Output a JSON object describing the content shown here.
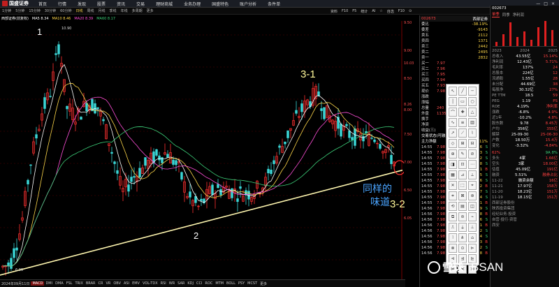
{
  "app": {
    "logo_text": "国盛证券",
    "menu": [
      "首页",
      "行情",
      "发现",
      "股票",
      "资讯",
      "交易",
      "理财商城",
      "业务办理",
      "国盛特色",
      "账户分析",
      "条件单"
    ],
    "right_icons": [
      "—",
      "□",
      "×"
    ]
  },
  "toolbar": {
    "periods": [
      "1分钟",
      "5分钟",
      "15分钟",
      "30分钟",
      "60分钟",
      "日线",
      "周线",
      "月线",
      "季线",
      "年线",
      "多周期",
      "更多"
    ],
    "active_period": "日线",
    "right_items": [
      "资料",
      "F10",
      "F5",
      "统计",
      "AI",
      "☆",
      "自选",
      "F10",
      "⊙"
    ]
  },
  "legend": {
    "stock": "西部证券(前复权)",
    "ma5": "MA5 8.34",
    "ma10": "MA10 8.46",
    "ma20": "MA20 8.39",
    "ma60": "MA60 8.17"
  },
  "chart": {
    "high_label": "10.90",
    "low_label": "6.05",
    "axis_labels": [
      "10.03",
      "9.50",
      "9.00",
      "8.50",
      "8.26",
      "8.00",
      "7.50",
      "7.00",
      "6.50",
      "6.05"
    ],
    "annotations": {
      "p1": "1",
      "p2": "2",
      "p31": "3-1",
      "p32": "3-2",
      "same_line1": "同样的",
      "same_line2": "味道"
    }
  },
  "bottom_tabs": [
    "2024年09月11日",
    "MACD",
    "DMI",
    "DMA",
    "FSL",
    "TRIX",
    "BRAR",
    "CR",
    "VR",
    "OBV",
    "ASI",
    "EMV",
    "VOL-TDX",
    "RSI",
    "WR",
    "SAR",
    "KDJ",
    "CCI",
    "ROC",
    "MTM",
    "BOLL",
    "PSY",
    "MCST",
    "更多"
  ],
  "bottom_active": "MACD",
  "orderbook": {
    "code": "002673",
    "name": "西部证券",
    "compare_label": "委比",
    "compare_value": "-38.19%",
    "diff_label": "委差",
    "diff_value": "-9143",
    "asks": [
      {
        "label": "卖五",
        "price": "",
        "vol": "2112"
      },
      {
        "label": "卖四",
        "price": "",
        "vol": "1371"
      },
      {
        "label": "卖三",
        "price": "",
        "vol": "2442"
      },
      {
        "label": "卖二",
        "price": "",
        "vol": "2495"
      },
      {
        "label": "卖一",
        "price": "",
        "vol": "2832"
      }
    ],
    "bids": [
      {
        "label": "买一",
        "price": "7.97",
        "vol": ""
      },
      {
        "label": "买二",
        "price": "7.96",
        "vol": ""
      },
      {
        "label": "买三",
        "price": "7.95",
        "vol": ""
      },
      {
        "label": "买四",
        "price": "7.94",
        "vol": ""
      },
      {
        "label": "买五",
        "price": "7.93",
        "vol": ""
      }
    ],
    "stats": [
      {
        "label": "现价",
        "value": "7.98"
      },
      {
        "label": "涨跌",
        "value": ""
      },
      {
        "label": "涨幅",
        "value": ""
      },
      {
        "label": "总量",
        "value": "240"
      },
      {
        "label": "外盘",
        "value": "1135"
      },
      {
        "label": "换手",
        "value": ""
      },
      {
        "label": "净资",
        "value": ""
      },
      {
        "label": "收益(三)",
        "value": ""
      }
    ],
    "status": "交易状态(可融资)",
    "flow": "主力净额",
    "flow_value": "-11%",
    "ticks": [
      {
        "t": "14:55",
        "p": "7.98",
        "v": "16",
        "f": "S"
      },
      {
        "t": "14:55",
        "p": "7.98",
        "v": "3",
        "f": "S"
      },
      {
        "t": "14:55",
        "p": "7.98",
        "v": "12",
        "f": "S"
      },
      {
        "t": "14:55",
        "p": "7.98",
        "v": "8",
        "f": "S"
      },
      {
        "t": "14:55",
        "p": "7.98",
        "v": "1",
        "f": "B"
      },
      {
        "t": "14:55",
        "p": "7.98",
        "v": "5",
        "f": "S"
      },
      {
        "t": "14:55",
        "p": "7.98",
        "v": "26",
        "f": "S"
      },
      {
        "t": "14:55",
        "p": "7.98",
        "v": "2",
        "f": "B"
      },
      {
        "t": "14:55",
        "p": "7.98",
        "v": "7",
        "f": "S"
      },
      {
        "t": "14:55",
        "p": "7.98",
        "v": "4",
        "f": "S"
      },
      {
        "t": "14:55",
        "p": "7.98",
        "v": "31",
        "f": "B"
      },
      {
        "t": "14:56",
        "p": "7.98",
        "v": "9",
        "f": "S"
      },
      {
        "t": "14:56",
        "p": "7.98",
        "v": "18",
        "f": "B"
      },
      {
        "t": "14:56",
        "p": "7.98",
        "v": "6",
        "f": "S"
      },
      {
        "t": "14:56",
        "p": "7.98",
        "v": "11",
        "f": "B"
      },
      {
        "t": "14:56",
        "p": "7.98",
        "v": "2",
        "f": "S"
      },
      {
        "t": "14:56",
        "p": "7.98",
        "v": "14",
        "f": "S"
      },
      {
        "t": "14:56",
        "p": "7.98",
        "v": "3",
        "f": "B"
      },
      {
        "t": "14:56",
        "p": "7.98",
        "v": "22",
        "f": "S"
      },
      {
        "t": "14:56",
        "p": "7.98",
        "v": "8",
        "f": "B"
      }
    ]
  },
  "panel": {
    "code": "002673",
    "tabs": [
      "单季",
      "同季",
      "净利润"
    ],
    "active_tab": "单季",
    "years": [
      "2023",
      "2024",
      "2025"
    ],
    "bar_values": [
      0.15,
      0.45,
      0.9,
      0.35,
      0.55,
      0.25,
      0.7,
      0.95,
      0.6
    ],
    "rows": [
      {
        "l": "总收入",
        "v": "43.55亿",
        "v2": "15.14%"
      },
      {
        "l": "净利润",
        "v": "12.43亿",
        "v2": "5.71%"
      },
      {
        "l": "毛利率",
        "v": "137%",
        "v2": "24"
      },
      {
        "l": "总股本",
        "v": "224亿",
        "v2": "12"
      },
      {
        "l": "流通股",
        "v": "1.55亿",
        "v2": "28"
      },
      {
        "l": "未分配",
        "v": "44.69亿",
        "v2": "38"
      },
      {
        "l": "每股净",
        "v": "30.32亿",
        "v2": "27%"
      },
      {
        "l": "PE TTM",
        "v": "18.5",
        "v2": "59"
      },
      {
        "l": "PEG",
        "v": "1.19",
        "v2": "PS"
      },
      {
        "l": "ROE",
        "v": "4.19%",
        "v2": "净利率"
      },
      {
        "l": "涨跌",
        "v": "-6.8%",
        "v2": "4.9%"
      },
      {
        "l": "近1年",
        "v": "-10.2%",
        "v2": "4.8%"
      },
      {
        "l": "股东数",
        "v": "9.78",
        "v2": "8.45万"
      },
      {
        "l": "户均",
        "v": "356亿",
        "v2": "355亿"
      },
      {
        "l": "解禁",
        "v": "25-09-30",
        "v2": "25-06-30"
      },
      {
        "l": "户数",
        "v": "18.50万",
        "v2": "15.4万"
      },
      {
        "l": "变化",
        "v": "-3.32%",
        "v2": "-4.84%"
      }
    ],
    "ratio_left": "62%",
    "ratio_right": "9A 8%",
    "quant": [
      {
        "l": "多头",
        "v": "4家",
        "v2": "1.66亿"
      },
      {
        "l": "空头",
        "v": "3家",
        "v2": "18.00亿"
      },
      {
        "l": "估值",
        "v": "45.09亿",
        "v2": "191亿"
      },
      {
        "l": "融资",
        "v": "5.51%",
        "v2": "融券占比"
      }
    ],
    "dates": [
      {
        "d": "11-22",
        "a": "融资余额",
        "b": "16亿"
      },
      {
        "d": "11-21",
        "a": "17.97亿",
        "b": "158万"
      },
      {
        "d": "11-20",
        "a": "18.23亿",
        "b": "151万"
      },
      {
        "d": "11-19",
        "a": "18.15亿",
        "b": "151万"
      }
    ],
    "company": [
      "西部证券股份",
      "陕西投资集团",
      "经纪业务·投资",
      "自营·投行·资管",
      "西安"
    ]
  },
  "watermark": {
    "text": "雪球",
    "brand": "BSAN"
  }
}
